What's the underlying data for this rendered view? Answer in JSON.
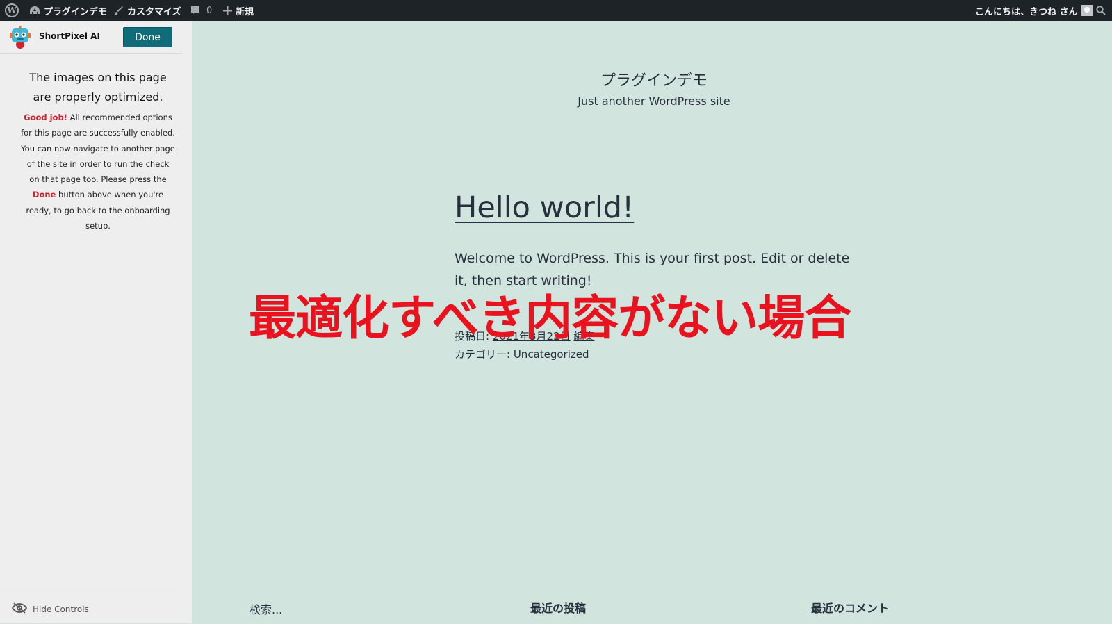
{
  "admin_bar": {
    "site_name": "プラグインデモ",
    "customize": "カスタマイズ",
    "comments_count": "0",
    "new": "新規",
    "greeting": "こんにちは、きつね さん",
    "icons": [
      "wordpress-icon",
      "dashboard-icon",
      "brush-icon",
      "comment-icon",
      "plus-icon",
      "avatar",
      "search-icon"
    ]
  },
  "shortpixel": {
    "name": "ShortPixel AI",
    "done_label": "Done",
    "title": "The images on this page are properly optimized.",
    "good_job": "Good job!",
    "body_1": " All recommended options for this page are successfully enabled. You can now navigate to another page of the site in order to run the check on that page too. Please press the ",
    "done_word": "Done",
    "body_2": " button above when you're ready, to go back to the onboarding setup.",
    "hide_controls": "Hide Controls",
    "accent_color": "#d5202f",
    "button_color": "#116c7a"
  },
  "site": {
    "title": "プラグインデモ",
    "description": "Just another WordPress site"
  },
  "post": {
    "title": "Hello world!",
    "content": "Welcome to WordPress. This is your first post. Edit or delete it, then start writing!",
    "posted_label": "投稿日: ",
    "date": "2021年3月22日",
    "edit": "編集",
    "category_label": "カテゴリー: ",
    "category": "Uncategorized"
  },
  "overlay_caption": "最適化すべき内容がない場合",
  "footer": {
    "search_placeholder": "検索...",
    "recent_posts": "最近の投稿",
    "recent_comments": "最近のコメント"
  },
  "colors": {
    "admin_bar_bg": "#1d2327",
    "page_bg": "#d2e4de",
    "sidebar_bg": "#eeeeee",
    "overlay_text": "#e8131e"
  }
}
